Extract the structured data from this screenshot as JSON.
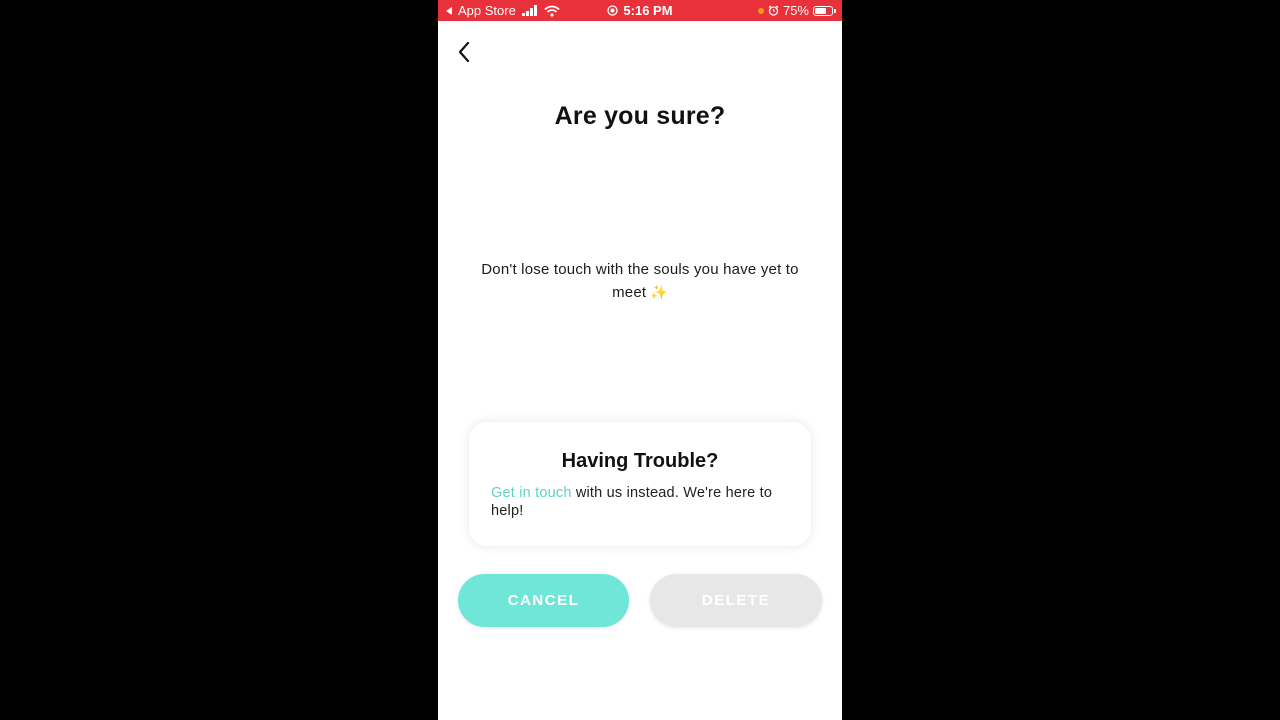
{
  "status_bar": {
    "back_app": "App Store",
    "time": "5:16 PM",
    "battery": "75%",
    "battery_level": 0.75,
    "icons": [
      "back-triangle-icon",
      "signal-icon",
      "wifi-icon",
      "screen-record-icon",
      "location-dot-icon",
      "alarm-icon",
      "battery-icon"
    ],
    "bar_color": "#e8313a"
  },
  "header": {
    "back_icon": "chevron-left-icon",
    "title": "Are you sure?"
  },
  "message": {
    "text": "Don't lose touch with the souls you have yet to meet",
    "emoji": "✨"
  },
  "help_card": {
    "title": "Having Trouble?",
    "link_text": "Get in touch",
    "body_text": " with us instead. We're here to help!",
    "link_color": "#5fd3c6"
  },
  "actions": {
    "cancel_label": "CANCEL",
    "delete_label": "DELETE",
    "cancel_color": "#6fe6d8",
    "delete_color": "#e7e7e7"
  }
}
